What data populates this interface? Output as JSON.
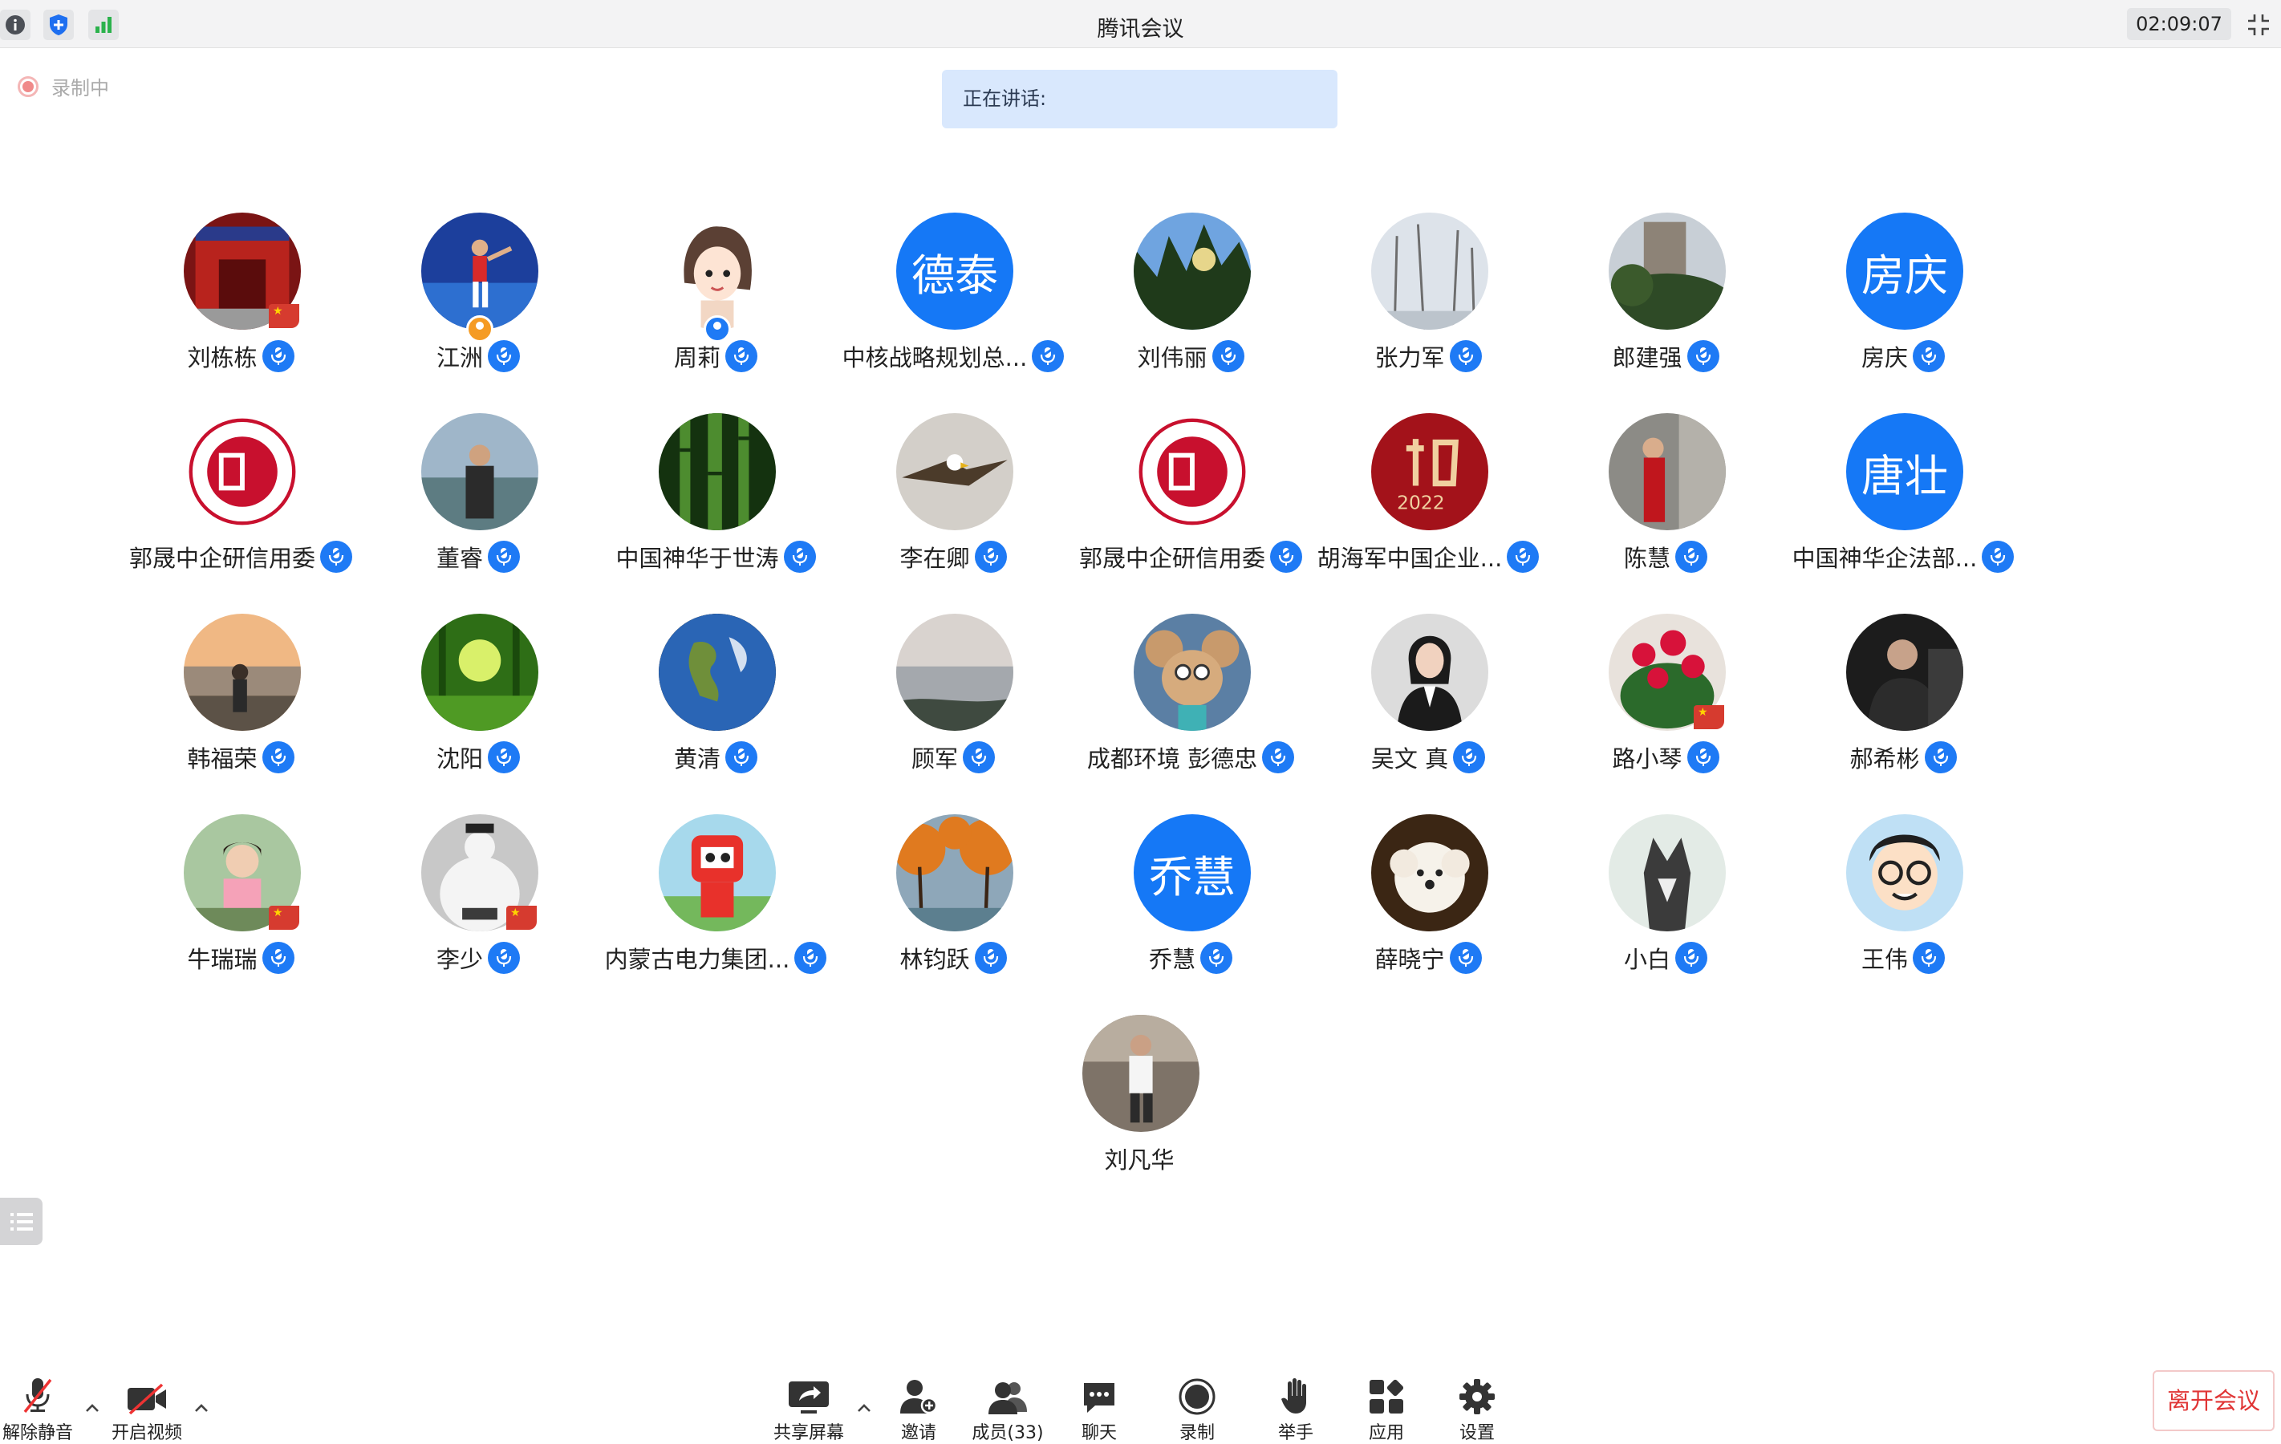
{
  "window": {
    "title": "腾讯会议",
    "timer": "02:09:07"
  },
  "recording": {
    "label": "录制中"
  },
  "speaking": {
    "label": "正在讲话:"
  },
  "participants": [
    {
      "name": "刘栋栋",
      "avatar": "photo-red-gate",
      "flag": true
    },
    {
      "name": "江洲",
      "avatar": "photo-tennis-player",
      "badge": "orange"
    },
    {
      "name": "周莉",
      "avatar": "cartoon-girl",
      "badge": "blue"
    },
    {
      "name": "中核战略规划总...",
      "avatar_text": "德泰"
    },
    {
      "name": "刘伟丽",
      "avatar": "photo-trees-sky"
    },
    {
      "name": "张力军",
      "avatar": "photo-winter-trees"
    },
    {
      "name": "郎建强",
      "avatar": "photo-building-trees"
    },
    {
      "name": "房庆",
      "avatar_text": "房庆"
    },
    {
      "name": "郭晟中企研信用委",
      "avatar": "logo-credit-seal"
    },
    {
      "name": "董睿",
      "avatar": "photo-man-suit-lake"
    },
    {
      "name": "中国神华于世涛",
      "avatar": "photo-bamboo"
    },
    {
      "name": "李在卿",
      "avatar": "photo-eagle"
    },
    {
      "name": "郭晟中企研信用委",
      "avatar": "logo-credit-seal"
    },
    {
      "name": "胡海军中国企业...",
      "avatar": "calligraphy-red"
    },
    {
      "name": "陈慧",
      "avatar": "photo-woman-red-dress"
    },
    {
      "name": "中国神华企法部...",
      "avatar_text": "唐壮"
    },
    {
      "name": "韩福荣",
      "avatar": "photo-man-seaside"
    },
    {
      "name": "沈阳",
      "avatar": "photo-green-forest"
    },
    {
      "name": "黄清",
      "avatar": "photo-earth"
    },
    {
      "name": "顾军",
      "avatar": "photo-lake-misty"
    },
    {
      "name": "成都环境 彭德忠",
      "avatar": "cartoon-mouse"
    },
    {
      "name": "吴文 真",
      "avatar": "photo-woman-suit"
    },
    {
      "name": "路小琴",
      "avatar": "photo-red-flowers",
      "flag": true
    },
    {
      "name": "郝希彬",
      "avatar": "photo-man-dark"
    },
    {
      "name": "牛瑞瑞",
      "avatar": "photo-child",
      "flag": true
    },
    {
      "name": "李少",
      "avatar": "photo-white-statue",
      "flag": true
    },
    {
      "name": "内蒙古电力集团...",
      "avatar": "cartoon-red-robot"
    },
    {
      "name": "林钧跃",
      "avatar": "photo-autumn-trees"
    },
    {
      "name": "乔慧",
      "avatar_text": "乔慧"
    },
    {
      "name": "薛晓宁",
      "avatar": "photo-white-puppy"
    },
    {
      "name": "小白",
      "avatar": "photo-husky-dog"
    },
    {
      "name": "王伟",
      "avatar": "cartoon-glasses-boy"
    },
    {
      "name": "刘凡华",
      "avatar": "photo-man-running",
      "no_mic": true
    }
  ],
  "toolbar": {
    "unmute": "解除静音",
    "video": "开启视频",
    "share": "共享屏幕",
    "invite": "邀请",
    "members": "成员(33)",
    "chat": "聊天",
    "record": "录制",
    "raise_hand": "举手",
    "apps": "应用",
    "settings": "设置",
    "leave": "离开会议"
  },
  "colors": {
    "accent": "#1578f6",
    "leave": "#e03535",
    "speaking_bg": "#d9e8fd"
  }
}
